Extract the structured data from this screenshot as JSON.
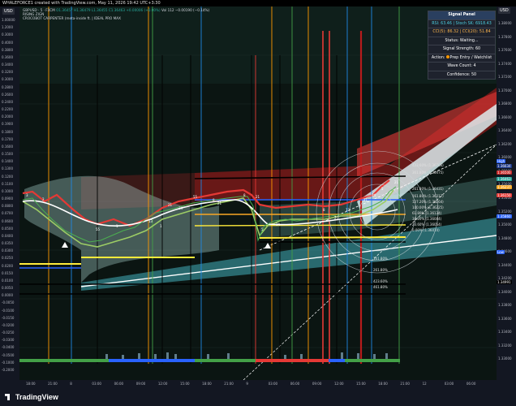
{
  "titlebar": "WHALEFORCE1 created with TradingView.com, May 11, 2026 19:42 UTC+3:30",
  "currency": "USD",
  "info": {
    "line1_symbol": "GBPUSD · 5 · FXCM",
    "line1_values": "O1.36457 H1.36479 L1.36455 C1.36463 +0.00006 (+0.00%)",
    "line1_vol": "Vol 112 −0.00190 (−0.14%)",
    "line2": "RISING ZIGN",
    "line3": "CROCOBOT CARPENTER (meta-inside ft. | IDEAL PRO MAX"
  },
  "signal_panel": {
    "title": "Signal Panel",
    "rsi": "RSI: 63.46 | Stoch SK: 6918.43",
    "cci": "CCI(5): 86.32 | CCI(20): 51.84",
    "status": "Status: Waiting...",
    "strength": "Signal Strength: 60",
    "action_label": "Action:",
    "action_value": "Prep Entry / Watchlist",
    "wave_count": "Wave Count: 4",
    "confidence": "Confidence: 50"
  },
  "left_ticks": [
    "1.00000",
    "1.2000",
    "0.3000",
    "0.4000",
    "0.3800",
    "0.3600",
    "0.3400",
    "0.3200",
    "0.3000",
    "0.2800",
    "0.2600",
    "0.2400",
    "0.2200",
    "0.2000",
    "0.1900",
    "0.1800",
    "0.1700",
    "0.1600",
    "0.1500",
    "0.1400",
    "0.1300",
    "0.1200",
    "0.1100",
    "0.1000",
    "0.0900",
    "0.0800",
    "0.0700",
    "0.0600",
    "0.0500",
    "0.0400",
    "0.0350",
    "0.0300",
    "0.0250",
    "0.0200",
    "0.0150",
    "0.0100",
    "0.0050",
    "0.0000",
    "-0.0050",
    "-0.0100",
    "-0.0150",
    "-0.0200",
    "-0.0250",
    "-0.0300",
    "-0.0400",
    "-0.0500",
    "-0.1000",
    "-0.2000"
  ],
  "right_ticks": [
    "1.38000",
    "1.37800",
    "1.37600",
    "1.37400",
    "1.37200",
    "1.37000",
    "1.36800",
    "1.36600",
    "1.36400",
    "1.36200",
    "1.36000",
    "1.35800",
    "1.35600",
    "1.35400",
    "1.35200",
    "1.35000",
    "1.34800",
    "1.34600",
    "1.34400",
    "1.34200",
    "1.34000",
    "1.33800",
    "1.33600",
    "1.33400",
    "1.33200",
    "1.33000"
  ],
  "right_labels": [
    {
      "text": "High",
      "color": "#2962ff"
    },
    {
      "text": "1.36634",
      "color": "#1e3a8a"
    },
    {
      "text": "1.36500",
      "color": "#c62828"
    },
    {
      "text": "1.36463",
      "color": "#26a69a"
    },
    {
      "text": "1.36237",
      "color": "#f9a825"
    },
    {
      "text": "1.36150",
      "color": "#e53935"
    },
    {
      "text": "1.35860",
      "color": "#2962ff"
    },
    {
      "text": "Low",
      "color": "#2962ff"
    },
    {
      "text": "1.34991",
      "color": "#000000"
    }
  ],
  "fib_levels": [
    "423.60% (1.36766)",
    "361.80% (1.36475)",
    "261.80% (1.36431)",
    "161.80% (1.36317)",
    "127.20% (1.36264)",
    "100.00% (1.36225)",
    "61.80% (1.36134)",
    "38.20% (1.36084)",
    "23.60% (1.36054)",
    "0.00% (1.36014)",
    "161.80%",
    "261.80%",
    "423.60%",
    "461.80%"
  ],
  "time_labels": [
    "18:00",
    "21:00",
    "8",
    "03:00",
    "06:00",
    "09:00",
    "12:00",
    "15:00",
    "18:00",
    "21:00",
    "9",
    "03:00",
    "06:00",
    "09:00",
    "12:00",
    "15:00",
    "18:00",
    "21:00",
    "12",
    "03:00",
    "06:00"
  ],
  "wave_labels": [
    "3",
    "2",
    "55",
    "1",
    "13",
    "1",
    "21",
    "34",
    "55",
    "8",
    "21",
    "8",
    "21",
    "5",
    "34",
    "8",
    "21",
    "13",
    "21",
    "34",
    "5",
    "21"
  ],
  "brand": "TradingView",
  "colors": {
    "bg": "#0d1a17",
    "red": "#e53935",
    "teal": "#4dd0e1",
    "yellow": "#ffeb3b",
    "blue": "#2962ff",
    "white": "#ffffff",
    "green": "#43a047"
  }
}
